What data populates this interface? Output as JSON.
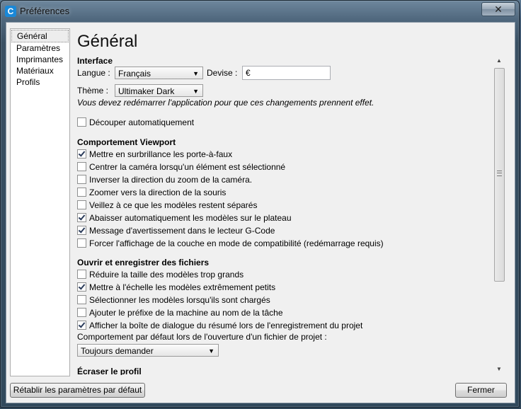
{
  "window": {
    "title": "Préférences",
    "app_icon_letter": "C",
    "close_glyph": "✕"
  },
  "sidebar": {
    "items": [
      {
        "label": "Général"
      },
      {
        "label": "Paramètres"
      },
      {
        "label": "Imprimantes"
      },
      {
        "label": "Matériaux"
      },
      {
        "label": "Profils"
      }
    ]
  },
  "page_title": "Général",
  "interface": {
    "title": "Interface",
    "language_label": "Langue :",
    "language_value": "Français",
    "currency_label": "Devise :",
    "currency_value": "€",
    "theme_label": "Thème :",
    "theme_value": "Ultimaker Dark",
    "restart_note": "Vous devez redémarrer l'application pour que ces changements prennent effet.",
    "auto_slice": {
      "label": "Découper automatiquement",
      "checked": false
    }
  },
  "viewport": {
    "title": "Comportement Viewport",
    "options": [
      {
        "label": "Mettre en surbrillance les porte-à-faux",
        "checked": true
      },
      {
        "label": "Centrer la caméra lorsqu'un élément est sélectionné",
        "checked": false
      },
      {
        "label": "Inverser la direction du zoom de la caméra.",
        "checked": false
      },
      {
        "label": "Zoomer vers la direction de la souris",
        "checked": false
      },
      {
        "label": "Veillez à ce que les modèles restent séparés",
        "checked": false
      },
      {
        "label": "Abaisser automatiquement les modèles sur le plateau",
        "checked": true
      },
      {
        "label": "Message d'avertissement dans le lecteur G-Code",
        "checked": true
      },
      {
        "label": "Forcer l'affichage de la couche en mode de compatibilité (redémarrage requis)",
        "checked": false
      }
    ]
  },
  "files": {
    "title": "Ouvrir et enregistrer des fichiers",
    "options": [
      {
        "label": "Réduire la taille des modèles trop grands",
        "checked": false
      },
      {
        "label": "Mettre à l'échelle les modèles extrêmement petits",
        "checked": true
      },
      {
        "label": "Sélectionner les modèles lorsqu'ils sont chargés",
        "checked": false
      },
      {
        "label": "Ajouter le préfixe de la machine au nom de la tâche",
        "checked": false
      },
      {
        "label": "Afficher la boîte de dialogue du résumé lors de l'enregistrement du projet",
        "checked": true
      }
    ],
    "default_behavior_label": "Comportement par défaut lors de l'ouverture d'un fichier de projet :",
    "default_behavior_value": "Toujours demander"
  },
  "override_profile": {
    "title": "Écraser le profil"
  },
  "buttons": {
    "reset": "Rétablir les paramètres par défaut",
    "close": "Fermer"
  }
}
